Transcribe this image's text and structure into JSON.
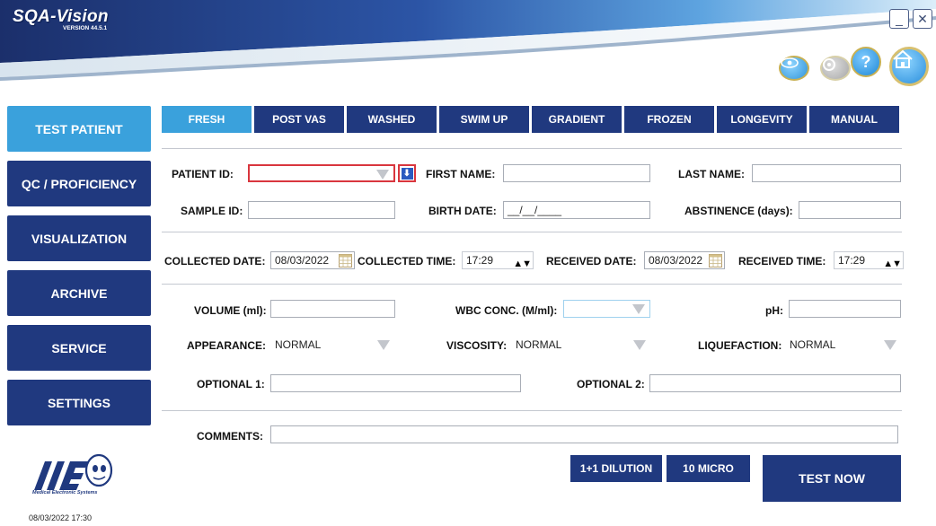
{
  "header": {
    "app_name": "SQA-Vision",
    "version": "VERSION 44.5.1",
    "minimize_glyph": "_",
    "close_glyph": "✕",
    "help_glyph": "?"
  },
  "sidebar": {
    "items": [
      {
        "label": "TEST PATIENT",
        "active": true
      },
      {
        "label": "QC / PROFICIENCY"
      },
      {
        "label": "VISUALIZATION"
      },
      {
        "label": "ARCHIVE"
      },
      {
        "label": "SERVICE"
      },
      {
        "label": "SETTINGS"
      }
    ],
    "logo_text": "Medical Electronic Systems",
    "datetime": "08/03/2022 17:30"
  },
  "tabs": [
    "FRESH",
    "POST VAS",
    "WASHED",
    "SWIM UP",
    "GRADIENT",
    "FROZEN",
    "LONGEVITY",
    "MANUAL"
  ],
  "form": {
    "patient_id_label": "PATIENT ID:",
    "first_name_label": "FIRST NAME:",
    "last_name_label": "LAST NAME:",
    "sample_id_label": "SAMPLE ID:",
    "birth_date_label": "BIRTH DATE:",
    "birth_date_value": "__/__/____",
    "abstinence_label": "ABSTINENCE (days):",
    "collected_date_label": "COLLECTED DATE:",
    "collected_date_value": "08/03/2022",
    "collected_time_label": "COLLECTED TIME:",
    "collected_time_value": "17:29",
    "received_date_label": "RECEIVED DATE:",
    "received_date_value": "08/03/2022",
    "received_time_label": "RECEIVED TIME:",
    "received_time_value": "17:29",
    "spin_glyph": "▲▼",
    "volume_label": "VOLUME (ml):",
    "wbc_label": "WBC CONC. (M/ml):",
    "ph_label": "pH:",
    "appearance_label": "APPEARANCE:",
    "appearance_value": "NORMAL",
    "viscosity_label": "VISCOSITY:",
    "viscosity_value": "NORMAL",
    "liquefaction_label": "LIQUEFACTION:",
    "liquefaction_value": "NORMAL",
    "optional1_label": "OPTIONAL 1:",
    "optional2_label": "OPTIONAL 2:",
    "comments_label": "COMMENTS:"
  },
  "actions": {
    "dilution": "1+1 DILUTION",
    "micro": "10 MICRO",
    "test_now": "TEST NOW"
  },
  "colors": {
    "navy": "#20397f",
    "active_blue": "#3aa1dc",
    "highlight_red": "#d9363e"
  }
}
